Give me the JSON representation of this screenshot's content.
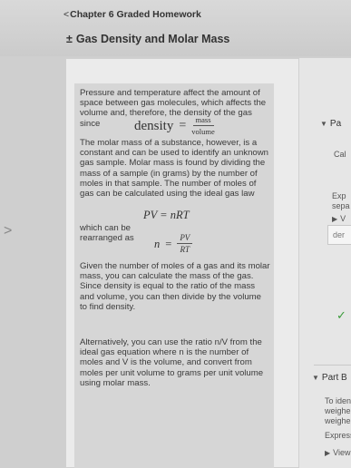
{
  "header": {
    "back_chevron": "<",
    "back_label": "Chapter 6 Graded Homework",
    "title_icon": "±",
    "title": "Gas Density and Molar Mass"
  },
  "nav": {
    "left_arrow": ">"
  },
  "intro": {
    "p1": "Pressure and temperature affect the amount of space between gas molecules, which affects the volume and, therefore, the density of the gas since",
    "density_word": "density",
    "density_eq": "=",
    "density_num": "mass",
    "density_den": "volume",
    "p2": "The molar mass of a substance, however, is a constant and can be used to identify an unknown gas sample. Molar mass is found by dividing the mass of a sample (in grams) by the number of moles in that sample. The number of moles of gas can be calculated using the ideal gas law",
    "ideal_gas": "PV = nRT",
    "p3": "which can be rearranged as",
    "rearr_lhs": "n",
    "rearr_eq": "=",
    "rearr_num": "PV",
    "rearr_den": "RT",
    "p4": "Given the number of moles of a gas and its molar mass, you can calculate the mass of the gas. Since density is equal to the ratio of the mass and volume, you can then divide by the volume to find density.",
    "p5": "Alternatively, you can use the ratio n/V from the ideal gas equation where n is the number of moles and V is the volume, and convert from moles per unit volume to grams per unit volume using molar mass."
  },
  "right_panel": {
    "part_a_label": "Pa",
    "part_a_text": "Cal",
    "exp_line1": "Exp",
    "exp_line2": "sepa",
    "view_label": "V",
    "input_value": "der",
    "check_icon": "✓",
    "part_b_label": "Part B",
    "partb_l1": "To iden",
    "partb_l2": "weighe",
    "partb_l3": "weighe",
    "express": "Express",
    "view_available": "View"
  },
  "colors": {
    "check": "#3a9b3a",
    "panel": "#e6e6e6"
  }
}
